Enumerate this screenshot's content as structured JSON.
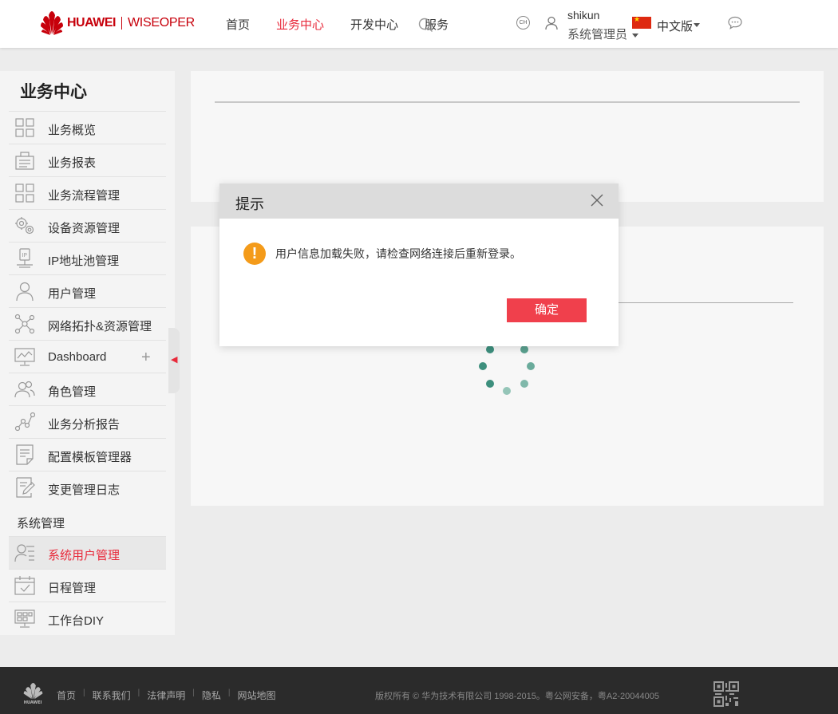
{
  "header": {
    "logo_brand": "HUAWEI",
    "logo_sub": "WISEOPER",
    "nav": [
      {
        "label": "首页",
        "active": false
      },
      {
        "label": "业务中心",
        "active": true
      },
      {
        "label": "开发中心",
        "active": false
      },
      {
        "label": "服务",
        "active": false
      }
    ],
    "ch_badge": "CH",
    "username": "shikun",
    "role": "系统管理员",
    "language": "中文版"
  },
  "sidebar": {
    "title": "业务中心",
    "items": [
      {
        "label": "业务概览",
        "icon": "grid-icon"
      },
      {
        "label": "业务报表",
        "icon": "report-icon"
      },
      {
        "label": "业务流程管理",
        "icon": "grid-icon"
      },
      {
        "label": "设备资源管理",
        "icon": "gears-icon"
      },
      {
        "label": "IP地址池管理",
        "icon": "ip-icon"
      },
      {
        "label": "用户管理",
        "icon": "user-icon"
      },
      {
        "label": "网络拓扑&资源管理",
        "icon": "topology-icon"
      },
      {
        "label": "Dashboard",
        "icon": "monitor-icon"
      },
      {
        "label": "角色管理",
        "icon": "group-icon"
      },
      {
        "label": "业务分析报告",
        "icon": "analytics-icon"
      },
      {
        "label": "配置模板管理器",
        "icon": "document-icon"
      },
      {
        "label": "变更管理日志",
        "icon": "edit-doc-icon"
      }
    ],
    "section2_title": "系统管理",
    "items2": [
      {
        "label": "系统用户管理",
        "icon": "user-list-icon",
        "active": true
      },
      {
        "label": "日程管理",
        "icon": "calendar-icon"
      },
      {
        "label": "工作台DIY",
        "icon": "workbench-icon"
      }
    ]
  },
  "modal": {
    "title": "提示",
    "message": "用户信息加载失败，请检查网络连接后重新登录。",
    "ok_label": "确定"
  },
  "footer": {
    "links": [
      "首页",
      "联系我们",
      "法律声明",
      "隐私",
      "网站地图"
    ],
    "copyright": "版权所有 © 华为技术有限公司 1998-2015。粤公网安备，粤A2-20044005"
  }
}
